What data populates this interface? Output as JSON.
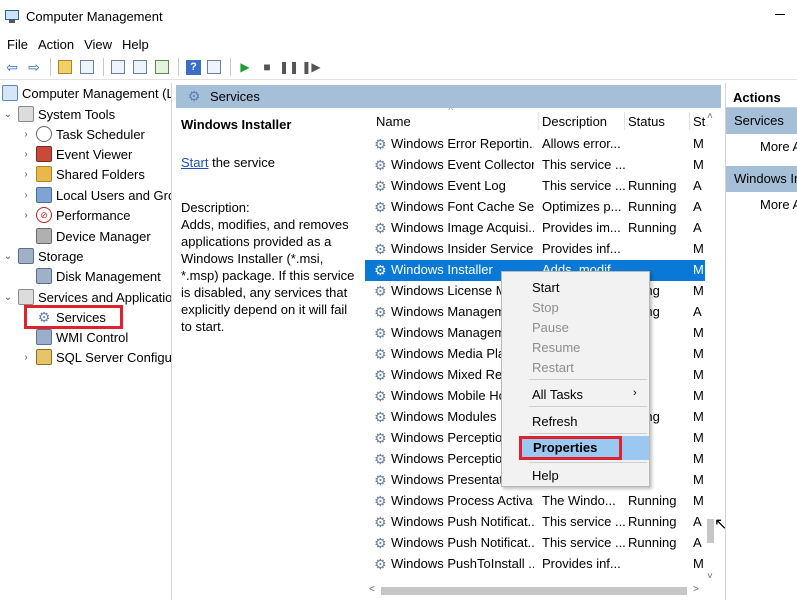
{
  "window": {
    "title": "Computer Management"
  },
  "menu": [
    "File",
    "Action",
    "View",
    "Help"
  ],
  "tree": {
    "items": [
      {
        "label": "Computer Management (L",
        "level": 0,
        "toggle": "",
        "icon": "computer-management-icon"
      },
      {
        "label": "System Tools",
        "level": 1,
        "toggle": "v",
        "icon": "system-tools-icon"
      },
      {
        "label": "Task Scheduler",
        "level": 2,
        "toggle": ">",
        "icon": "task-scheduler-icon"
      },
      {
        "label": "Event Viewer",
        "level": 2,
        "toggle": ">",
        "icon": "event-viewer-icon"
      },
      {
        "label": "Shared Folders",
        "level": 2,
        "toggle": ">",
        "icon": "shared-folders-icon"
      },
      {
        "label": "Local Users and Gro",
        "level": 2,
        "toggle": ">",
        "icon": "local-users-icon"
      },
      {
        "label": "Performance",
        "level": 2,
        "toggle": ">",
        "icon": "performance-icon"
      },
      {
        "label": "Device Manager",
        "level": 2,
        "toggle": "",
        "icon": "device-manager-icon"
      },
      {
        "label": "Storage",
        "level": 1,
        "toggle": "v",
        "icon": "storage-icon"
      },
      {
        "label": "Disk Management",
        "level": 2,
        "toggle": "",
        "icon": "disk-management-icon"
      },
      {
        "label": "Services and Applicatio",
        "level": 1,
        "toggle": "v",
        "icon": "services-applications-icon"
      },
      {
        "label": "Services",
        "level": 2,
        "toggle": "",
        "icon": "services-icon",
        "selected": true
      },
      {
        "label": "WMI Control",
        "level": 2,
        "toggle": "",
        "icon": "wmi-control-icon"
      },
      {
        "label": "SQL Server Configur",
        "level": 2,
        "toggle": ">",
        "icon": "sql-server-icon"
      }
    ]
  },
  "center": {
    "header": "Services",
    "detail": {
      "title": "Windows Installer",
      "start_link": "Start",
      "start_rest": " the service",
      "desc_label": "Description:",
      "desc_text": "Adds, modifies, and removes applications provided as a Windows Installer (*.msi, *.msp) package. If this service is disabled, any services that explicitly depend on it will fail to start."
    },
    "columns": [
      "Name",
      "Description",
      "Status",
      "St"
    ],
    "rows": [
      {
        "name": "Windows Error Reportin...",
        "desc": "Allows error...",
        "status": "",
        "st": "M"
      },
      {
        "name": "Windows Event Collector",
        "desc": "This service ...",
        "status": "",
        "st": "M"
      },
      {
        "name": "Windows Event Log",
        "desc": "This service ...",
        "status": "Running",
        "st": "A"
      },
      {
        "name": "Windows Font Cache Se...",
        "desc": "Optimizes p...",
        "status": "Running",
        "st": "A"
      },
      {
        "name": "Windows Image Acquisi...",
        "desc": "Provides im...",
        "status": "Running",
        "st": "A"
      },
      {
        "name": "Windows Insider Service",
        "desc": "Provides inf...",
        "status": "",
        "st": "M"
      },
      {
        "name": "Windows Installer",
        "desc": "Adds, modif...",
        "status": "",
        "st": "M",
        "selected": true
      },
      {
        "name": "Windows License M",
        "desc": "",
        "status": "nning",
        "st": "M"
      },
      {
        "name": "Windows Managem",
        "desc": "",
        "status": "nning",
        "st": "A"
      },
      {
        "name": "Windows Managem",
        "desc": "",
        "status": "",
        "st": "M"
      },
      {
        "name": "Windows Media Pla",
        "desc": "",
        "status": "",
        "st": "M"
      },
      {
        "name": "Windows Mixed Rea",
        "desc": "",
        "status": "",
        "st": "M"
      },
      {
        "name": "Windows Mobile Ho",
        "desc": "",
        "status": "",
        "st": "M"
      },
      {
        "name": "Windows Modules",
        "desc": "",
        "status": "nning",
        "st": "M"
      },
      {
        "name": "Windows Perception",
        "desc": "",
        "status": "",
        "st": "M"
      },
      {
        "name": "Windows Perception",
        "desc": "",
        "status": "",
        "st": "M"
      },
      {
        "name": "Windows Presentat",
        "desc": "",
        "status": "",
        "st": "M"
      },
      {
        "name": "Windows Process Activa...",
        "desc": "The Windo...",
        "status": "Running",
        "st": "M"
      },
      {
        "name": "Windows Push Notificat...",
        "desc": "This service ...",
        "status": "Running",
        "st": "A"
      },
      {
        "name": "Windows Push Notificat...",
        "desc": "This service ...",
        "status": "Running",
        "st": "A"
      },
      {
        "name": "Windows PushToInstall ...",
        "desc": "Provides inf...",
        "status": "",
        "st": "M"
      }
    ]
  },
  "context_menu": {
    "start": "Start",
    "stop": "Stop",
    "pause": "Pause",
    "resume": "Resume",
    "restart": "Restart",
    "all_tasks": "All Tasks",
    "refresh": "Refresh",
    "properties": "Properties",
    "help": "Help"
  },
  "actions": {
    "title": "Actions",
    "section1": "Services",
    "more1": "More A",
    "section2": "Windows In",
    "more2": "More A"
  },
  "colors": {
    "selection": "#0a78d7",
    "header": "#a6bfd9",
    "highlight_box": "#e0212f",
    "menu_hover": "#99c9f0"
  }
}
